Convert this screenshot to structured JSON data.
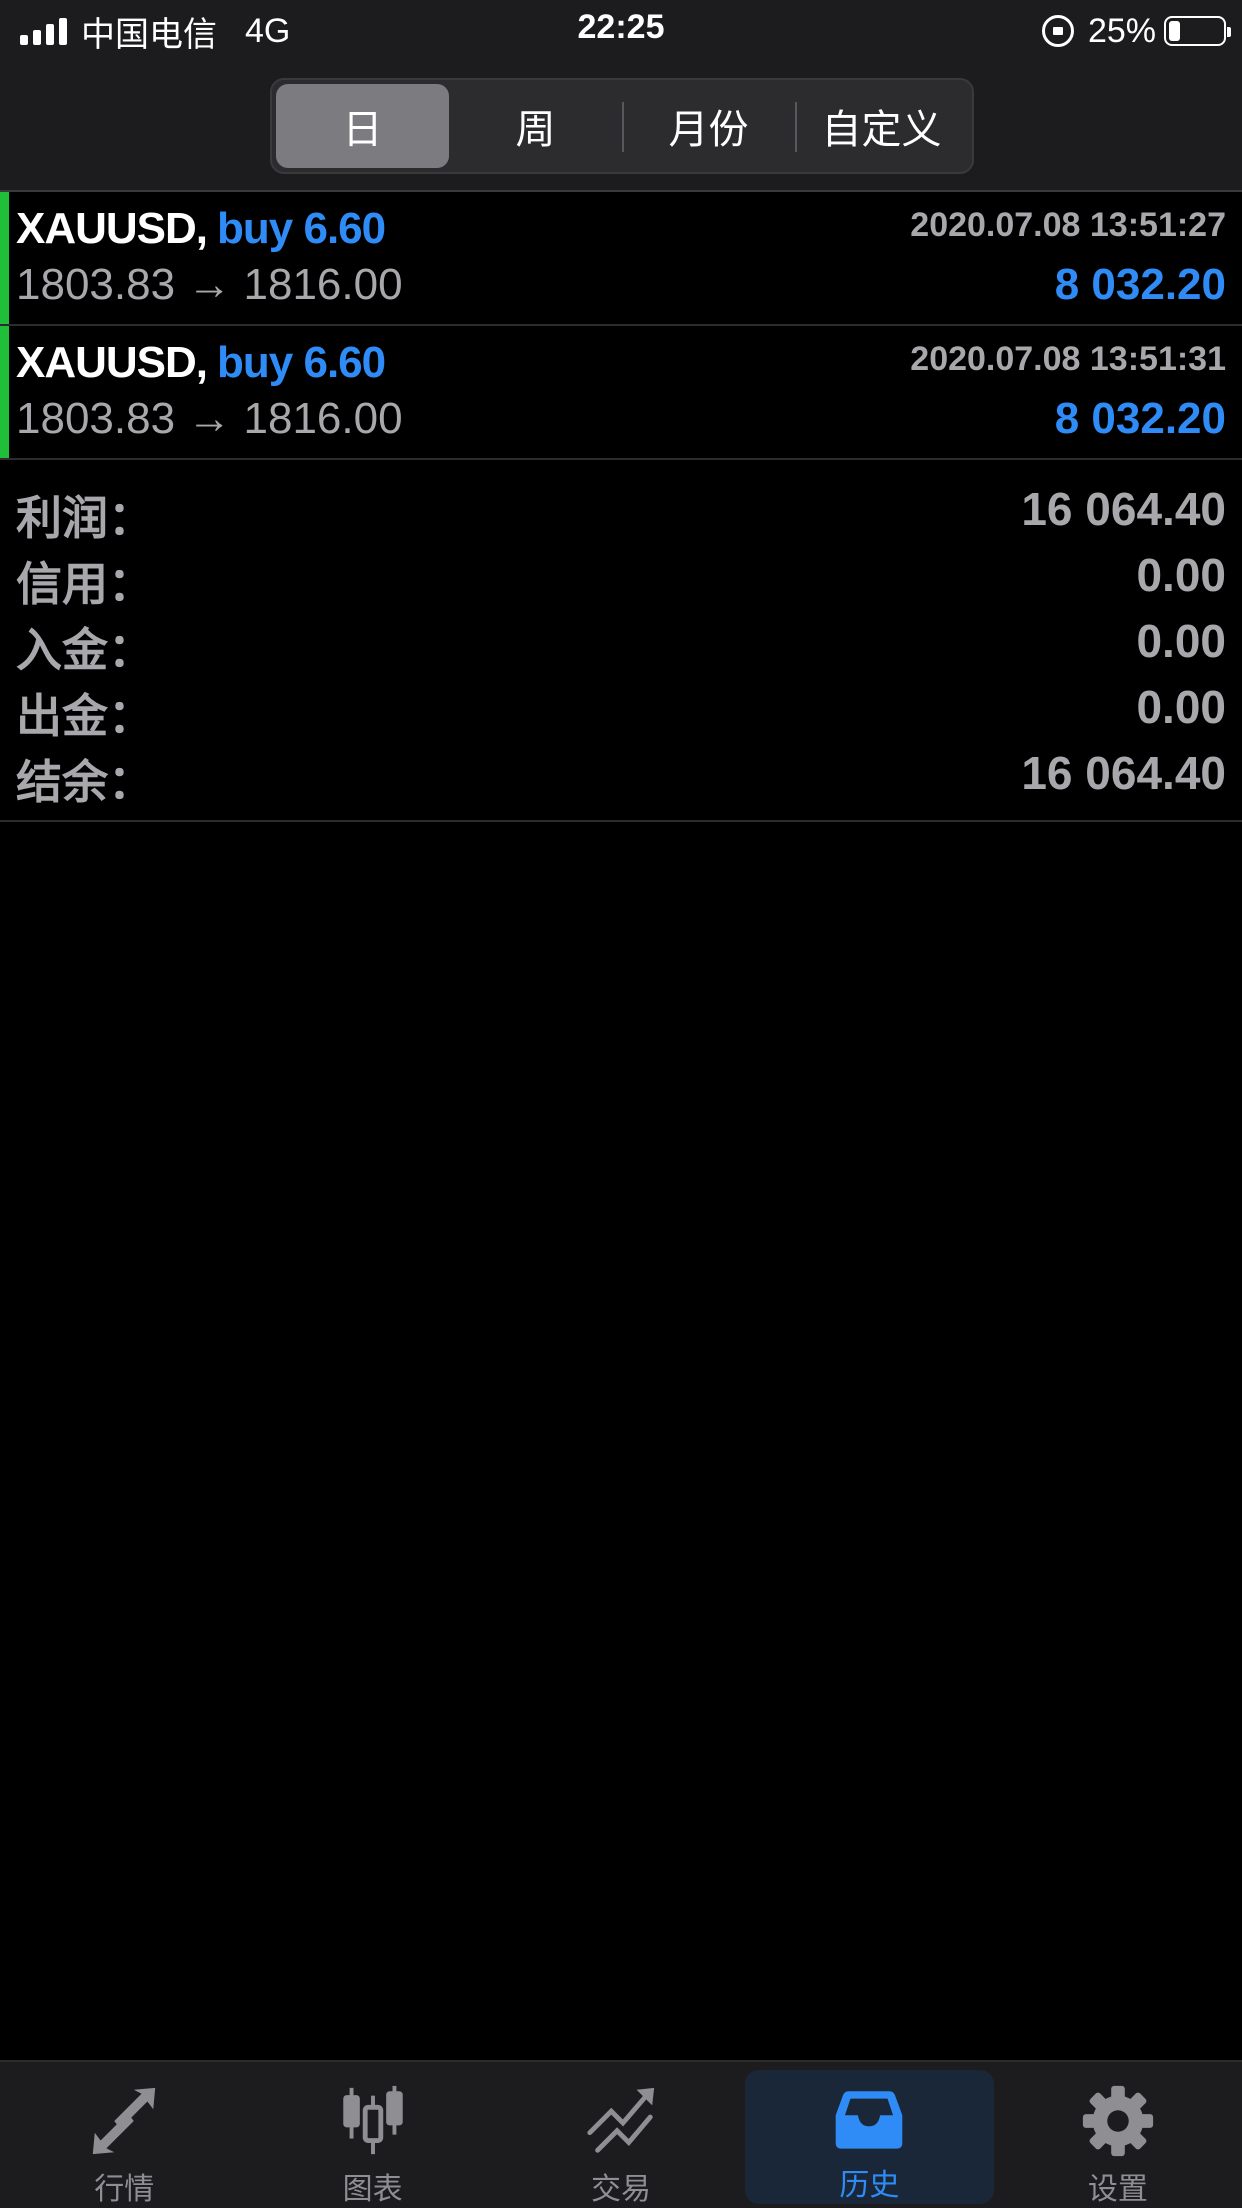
{
  "status_bar": {
    "carrier": "中国电信",
    "network": "4G",
    "time": "22:25",
    "battery": "25%"
  },
  "segmented": {
    "tabs": [
      "日",
      "周",
      "月份",
      "自定义"
    ],
    "active": "日"
  },
  "deals": [
    {
      "symbol": "XAUUSD,",
      "type": "buy 6.60",
      "time": "2020.07.08 13:51:27",
      "prices": "1803.83 → 1816.00",
      "profit": "8 032.20"
    },
    {
      "symbol": "XAUUSD,",
      "type": "buy 6.60",
      "time": "2020.07.08 13:51:31",
      "prices": "1803.83 → 1816.00",
      "profit": "8 032.20"
    }
  ],
  "summary": [
    {
      "label": "利润：",
      "value": "16 064.40"
    },
    {
      "label": "信用：",
      "value": "0.00"
    },
    {
      "label": "入金：",
      "value": "0.00"
    },
    {
      "label": "出金：",
      "value": "0.00"
    },
    {
      "label": "结余：",
      "value": "16 064.40"
    }
  ],
  "tabbar": {
    "items": [
      {
        "label": "行情",
        "icon": "quotes-arrows-icon"
      },
      {
        "label": "图表",
        "icon": "candlestick-chart-icon"
      },
      {
        "label": "交易",
        "icon": "trade-trend-icon"
      },
      {
        "label": "历史",
        "icon": "inbox-tray-icon"
      },
      {
        "label": "设置",
        "icon": "gear-icon"
      }
    ],
    "active": "历史"
  },
  "colors": {
    "accent_blue": "#2f8cf6",
    "buy_bar_green": "#1fbf3a",
    "muted_text": "#a8a8ac",
    "background": "#000000"
  }
}
